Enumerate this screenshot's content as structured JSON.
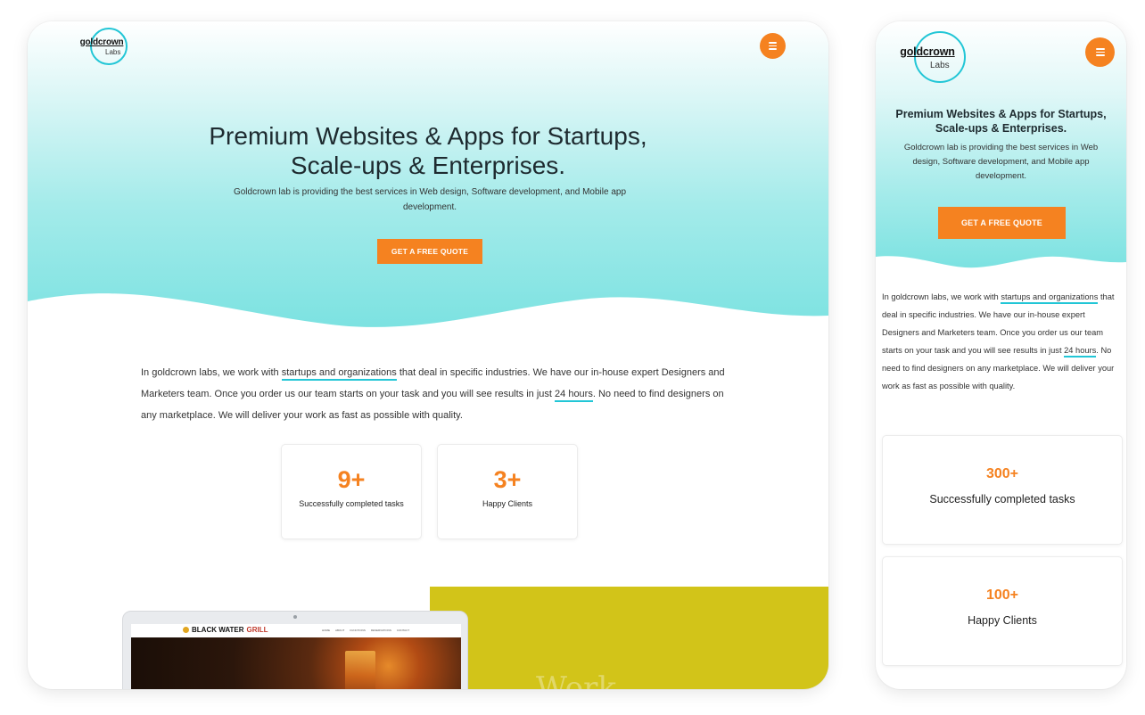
{
  "colors": {
    "accent": "#f58220",
    "teal": "#22c6d6",
    "hero_gradient_end": "#7fe3e2",
    "work_block": "#d2c419"
  },
  "logo": {
    "word": "goldcrown",
    "sub": "Labs"
  },
  "menu_icon": "hamburger-icon",
  "hero": {
    "title_line1": "Premium Websites & Apps for Startups,",
    "title_line2": "Scale-ups & Enterprises.",
    "mobile_title": "Premium Websites & Apps for Startups, Scale-ups & Enterprises.",
    "subtitle": "Goldcrown lab is providing the best services in Web design, Software development, and Mobile app development.",
    "cta": "GET A FREE QUOTE"
  },
  "intro": {
    "part1": "In goldcrown labs, we work with ",
    "highlight1": "startups and organizations",
    "part2": " that deal in specific industries. We have our in-house expert Designers and Marketers team. Once you order us our team starts on your task and you will see results in just ",
    "highlight2": "24 hours",
    "part3": ". No need to find designers on any marketplace. We will deliver your work as fast as possible with quality."
  },
  "desktop_stats": [
    {
      "value": "9+",
      "label": "Successfully completed tasks"
    },
    {
      "value": "3+",
      "label": "Happy Clients"
    }
  ],
  "mobile_stats": [
    {
      "value": "300+",
      "label": "Successfully completed tasks"
    },
    {
      "value": "100+",
      "label": "Happy Clients"
    }
  ],
  "portfolio": {
    "site_name_part1": "BLACK WATER",
    "site_name_part2": "GRILL",
    "nav_links": [
      "HOME",
      "ABOUT",
      "FUNCTIONS",
      "RESERVATIONS",
      "CONTACT"
    ],
    "work_heading": "Work"
  }
}
